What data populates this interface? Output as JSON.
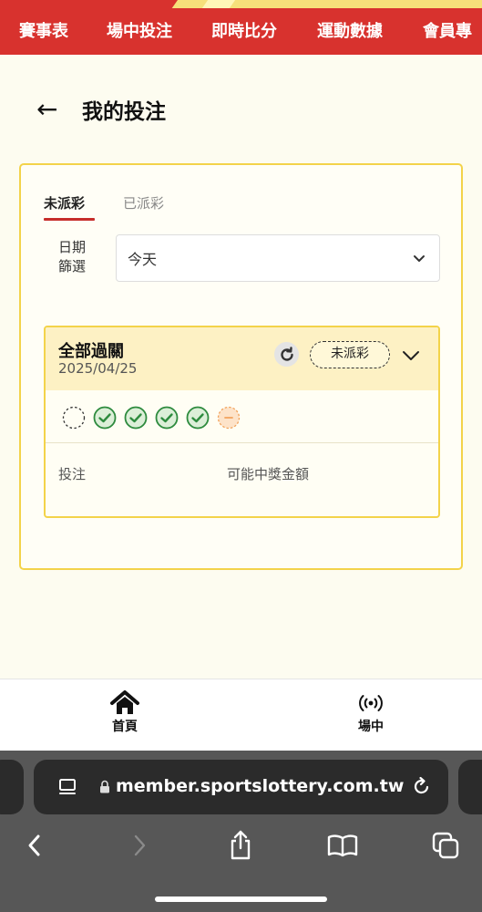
{
  "top_nav": {
    "items": [
      {
        "label": "賽事表"
      },
      {
        "label": "場中投注"
      },
      {
        "label": "即時比分"
      },
      {
        "label": "運動數據"
      },
      {
        "label": "會員專"
      }
    ]
  },
  "page": {
    "back_icon": "back-arrow-icon",
    "title": "我的投注"
  },
  "tabs": [
    {
      "label": "未派彩",
      "active": true
    },
    {
      "label": "已派彩",
      "active": false
    }
  ],
  "date_filter": {
    "label": "日期\n篩選",
    "value": "今天"
  },
  "bet": {
    "type": "全部過關",
    "date": "2025/04/25",
    "status": "未派彩",
    "legs": [
      {
        "state": "pending",
        "icon": "dashed-circle-icon"
      },
      {
        "state": "won",
        "icon": "check-circle-icon"
      },
      {
        "state": "won",
        "icon": "check-circle-icon"
      },
      {
        "state": "won",
        "icon": "check-circle-icon"
      },
      {
        "state": "won",
        "icon": "check-circle-icon"
      },
      {
        "state": "void",
        "icon": "minus-circle-icon"
      }
    ],
    "columns": {
      "stake": "投注",
      "payout": "可能中獎金額"
    }
  },
  "bottom_nav": {
    "items": [
      {
        "label": "首頁",
        "icon": "home-icon"
      },
      {
        "label": "場中",
        "icon": "live-broadcast-icon"
      }
    ]
  },
  "browser": {
    "url": "member.sportslottery.com.tw"
  },
  "colors": {
    "brand_red": "#d8322e",
    "accent_yellow": "#f3d34a",
    "won_green": "#2e8b3e",
    "void_orange": "#f2a35c"
  }
}
